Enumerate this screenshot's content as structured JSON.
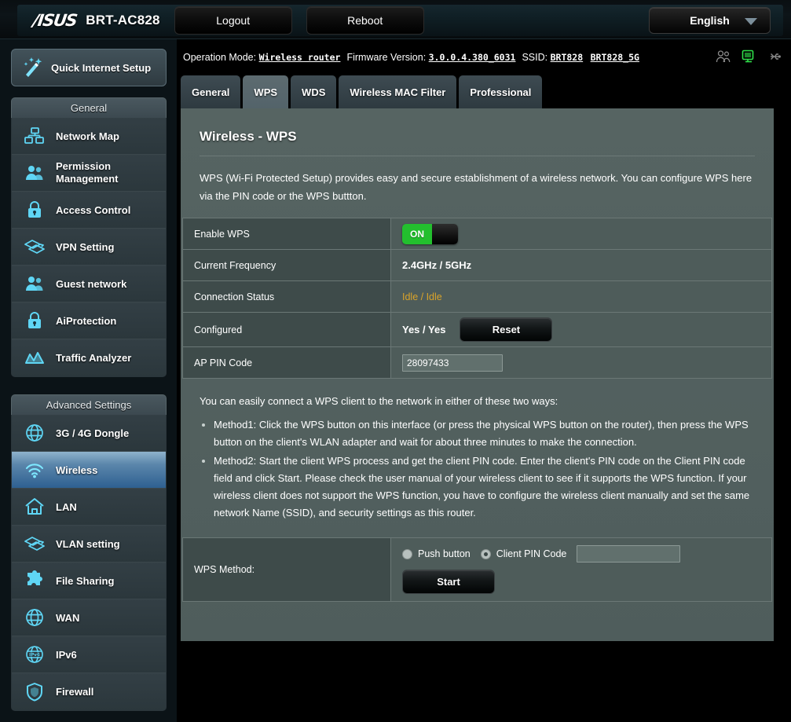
{
  "topbar": {
    "brand": "/ISUS",
    "model": "BRT-AC828",
    "logout_label": "Logout",
    "reboot_label": "Reboot",
    "language": "English"
  },
  "sidebar": {
    "quick_setup_label": "Quick Internet Setup",
    "groups": [
      {
        "title": "General",
        "items": [
          {
            "label": "Network Map",
            "icon": "network-map-icon",
            "active": false
          },
          {
            "label": "Permission Management",
            "icon": "permission-management-icon",
            "active": false
          },
          {
            "label": "Access Control",
            "icon": "lock-icon",
            "active": false
          },
          {
            "label": "VPN Setting",
            "icon": "vpn-icon",
            "active": false
          },
          {
            "label": "Guest network",
            "icon": "guest-network-icon",
            "active": false
          },
          {
            "label": "AiProtection",
            "icon": "lock-icon",
            "active": false
          },
          {
            "label": "Traffic Analyzer",
            "icon": "traffic-analyzer-icon",
            "active": false
          }
        ]
      },
      {
        "title": "Advanced Settings",
        "items": [
          {
            "label": "3G / 4G Dongle",
            "icon": "globe-icon",
            "active": false
          },
          {
            "label": "Wireless",
            "icon": "wifi-icon",
            "active": true
          },
          {
            "label": "LAN",
            "icon": "home-icon",
            "active": false
          },
          {
            "label": "VLAN setting",
            "icon": "vpn-icon",
            "active": false
          },
          {
            "label": "File Sharing",
            "icon": "puzzle-icon",
            "active": false
          },
          {
            "label": "WAN",
            "icon": "globe-icon",
            "active": false
          },
          {
            "label": "IPv6",
            "icon": "ipv6-globe-icon",
            "active": false
          },
          {
            "label": "Firewall",
            "icon": "shield-icon",
            "active": false
          }
        ]
      }
    ]
  },
  "infobar": {
    "operation_mode_label": "Operation Mode:",
    "operation_mode_value": "Wireless router",
    "firmware_label": "Firmware Version:",
    "firmware_value": "3.0.0.4.380_6031",
    "ssid_label": "SSID:",
    "ssid_24": "BRT828",
    "ssid_5g": "BRT828_5G"
  },
  "tabs": [
    {
      "label": "General",
      "active": false
    },
    {
      "label": "WPS",
      "active": true
    },
    {
      "label": "WDS",
      "active": false
    },
    {
      "label": "Wireless MAC Filter",
      "active": false
    },
    {
      "label": "Professional",
      "active": false
    }
  ],
  "page": {
    "title": "Wireless - WPS",
    "description": "WPS (Wi-Fi Protected Setup) provides easy and secure establishment of a wireless network. You can configure WPS here via the PIN code or the WPS buttton."
  },
  "settings": {
    "rows": [
      {
        "key": "Enable WPS",
        "type": "toggle",
        "toggle_label": "ON",
        "value": "ON"
      },
      {
        "key": "Current Frequency",
        "type": "text",
        "value": "2.4GHz / 5GHz"
      },
      {
        "key": "Connection Status",
        "type": "status",
        "value": "Idle / Idle"
      },
      {
        "key": "Configured",
        "type": "configured",
        "value": "Yes / Yes",
        "button_label": "Reset"
      },
      {
        "key": "AP PIN Code",
        "type": "input",
        "value": "28097433"
      }
    ]
  },
  "howto": {
    "intro": "You can easily connect a WPS client to the network in either of these two ways:",
    "methods": [
      "Method1: Click the WPS button on this interface (or press the physical WPS button on the router), then press the WPS button on the client's WLAN adapter and wait for about three minutes to make the connection.",
      "Method2: Start the client WPS process and get the client PIN code. Enter the client's PIN code on the Client PIN code field and click Start. Please check the user manual of your wireless client to see if it supports the WPS function. If your wireless client does not support the WPS function, you have to configure the wireless client manually and set the same network Name (SSID), and security settings as this router."
    ]
  },
  "wps_method": {
    "label": "WPS Method:",
    "push_button_label": "Push button",
    "push_button_checked": false,
    "client_pin_label": "Client PIN Code",
    "client_pin_checked": true,
    "client_pin_value": "",
    "client_pin_placeholder": "",
    "start_label": "Start"
  },
  "colors": {
    "accent_blue": "#2e6091",
    "toggle_green": "#23bf2e",
    "status_amber": "#d9a32a",
    "panel_bg": "#4e5c5a",
    "sidebar_item": "#333f45",
    "icon_cyan": "#4fd3f5"
  }
}
